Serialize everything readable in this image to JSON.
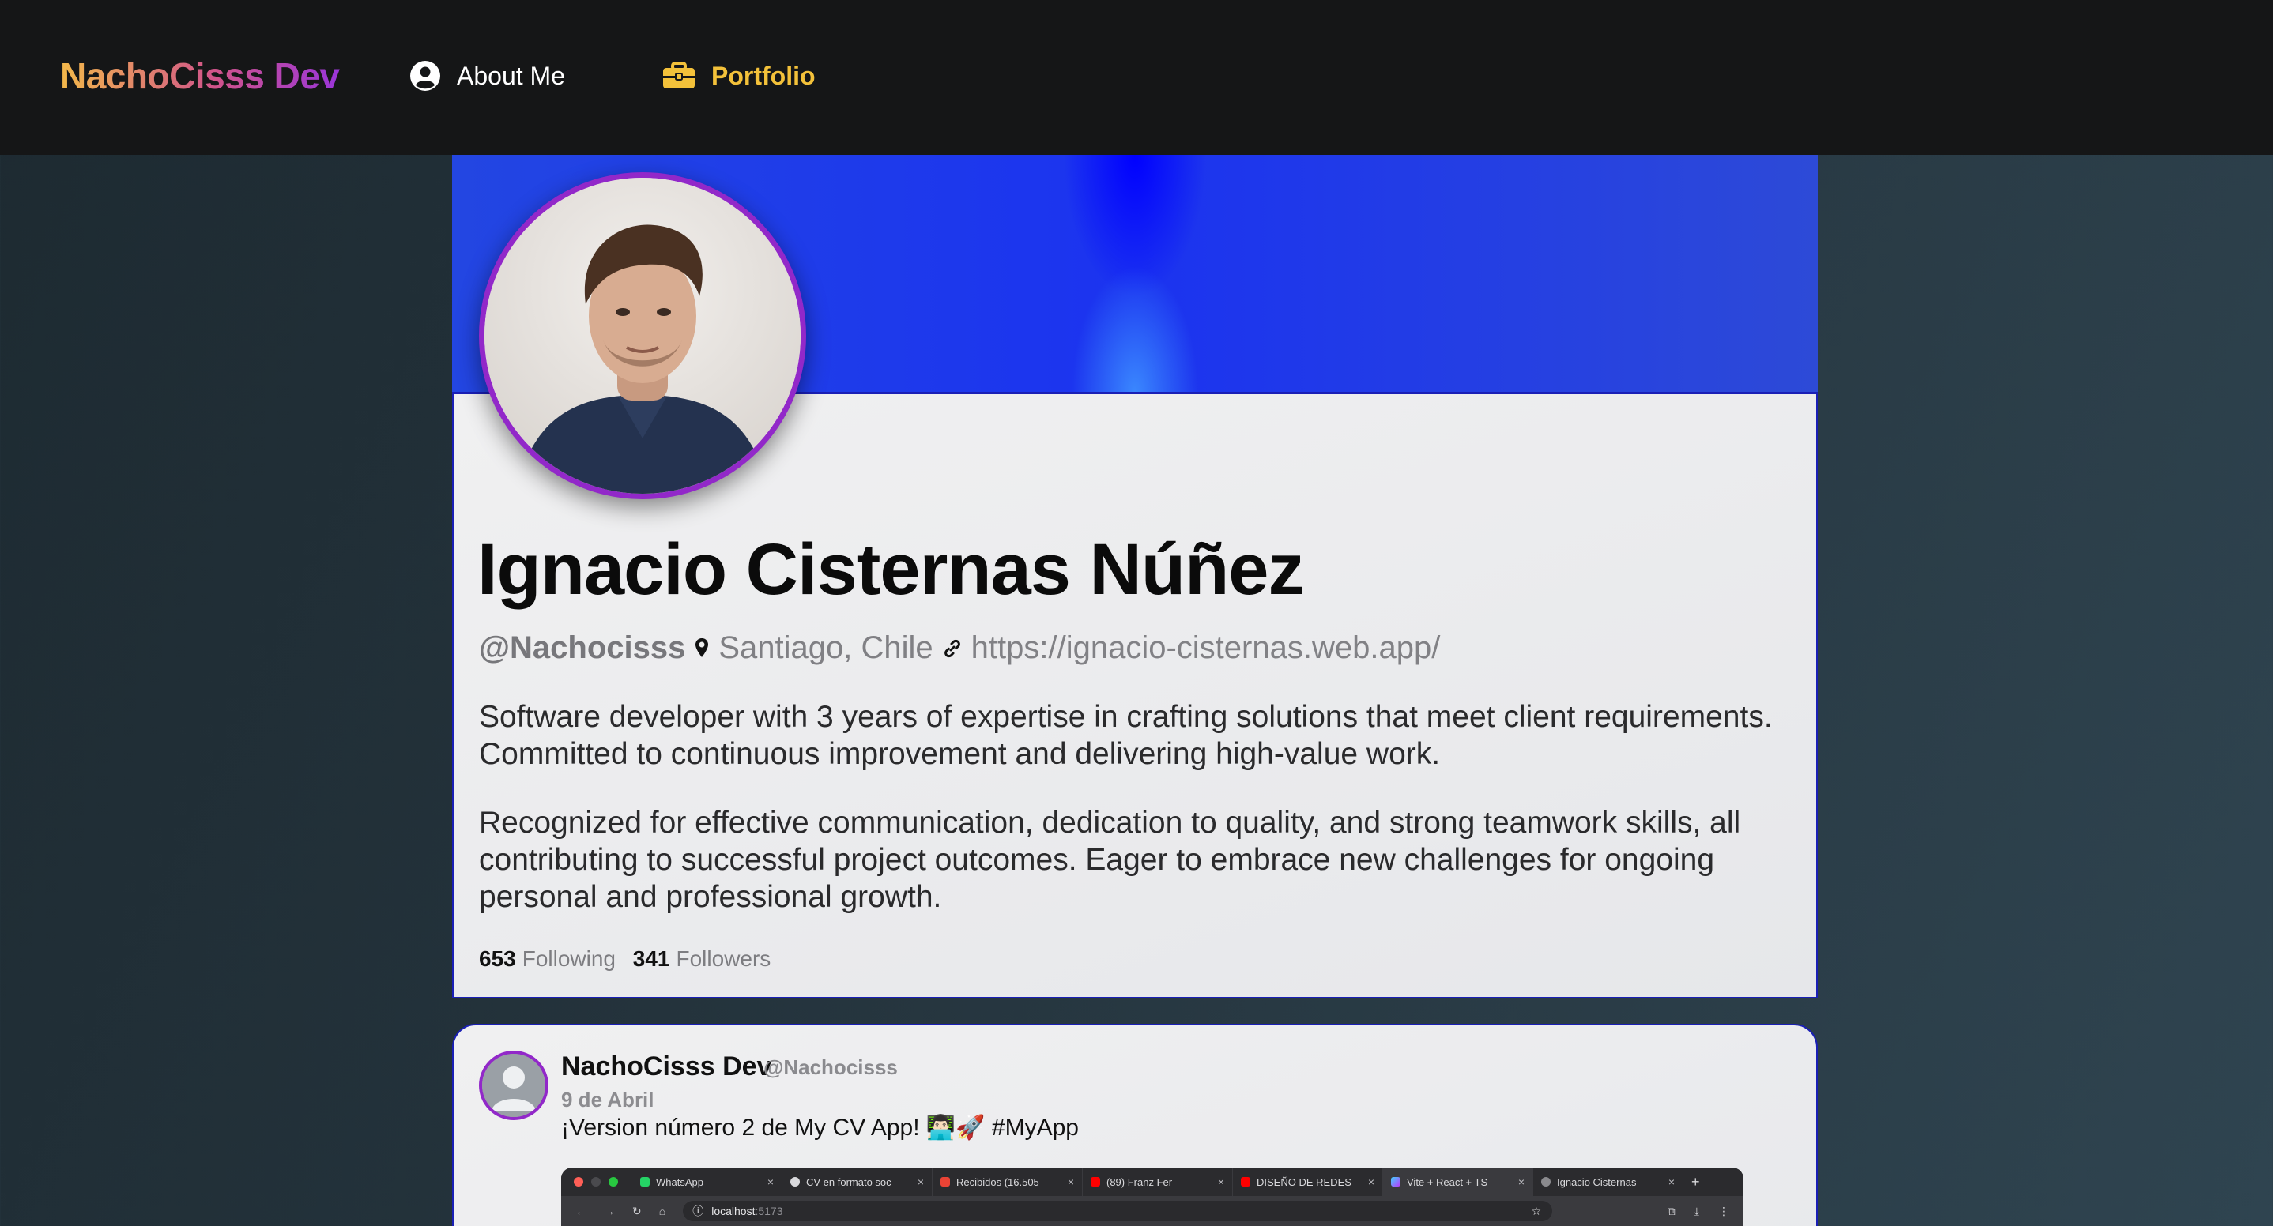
{
  "navbar": {
    "brand": "NachoCisss Dev",
    "items": [
      {
        "label": "About Me",
        "icon": "user-circle-icon",
        "active": false
      },
      {
        "label": "Portfolio",
        "icon": "briefcase-icon",
        "active": true
      }
    ]
  },
  "colors": {
    "navbar_bg": "#151617",
    "accent_yellow": "#f3c13a",
    "avatar_ring": "#9228c9",
    "card_border": "#1a1fb6",
    "banner_blue": "#1b33f0"
  },
  "profile": {
    "name": "Ignacio Cisternas Núñez",
    "handle": "@Nachocisss",
    "location": "Santiago, Chile",
    "website": "https://ignacio-cisternas.web.app/",
    "bio": [
      "Software developer with 3 years of expertise in crafting solutions that meet client requirements. Committed to continuous improvement and delivering high-value work.",
      "Recognized for effective communication, dedication to quality, and strong teamwork skills, all contributing to successful project outcomes. Eager to embrace new challenges for ongoing personal and professional growth."
    ],
    "following_count": "653",
    "following_label": "Following",
    "followers_count": "341",
    "followers_label": "Followers"
  },
  "post": {
    "author": "NachoCisss Dev",
    "handle": "@Nachocisss",
    "date": "9 de Abril",
    "text": "¡Version número 2 de My CV App! 👨🏻‍💻🚀 #MyApp",
    "screenshot": {
      "tabs": [
        "WhatsApp",
        "CV en formato soc",
        "Recibidos (16.505",
        "(89) Franz Fer",
        "DISEÑO DE REDES",
        "Vite + React + TS",
        "Ignacio Cisternas"
      ],
      "active_tab_index": 5,
      "url_host": "localhost",
      "url_port": ":5173"
    }
  }
}
